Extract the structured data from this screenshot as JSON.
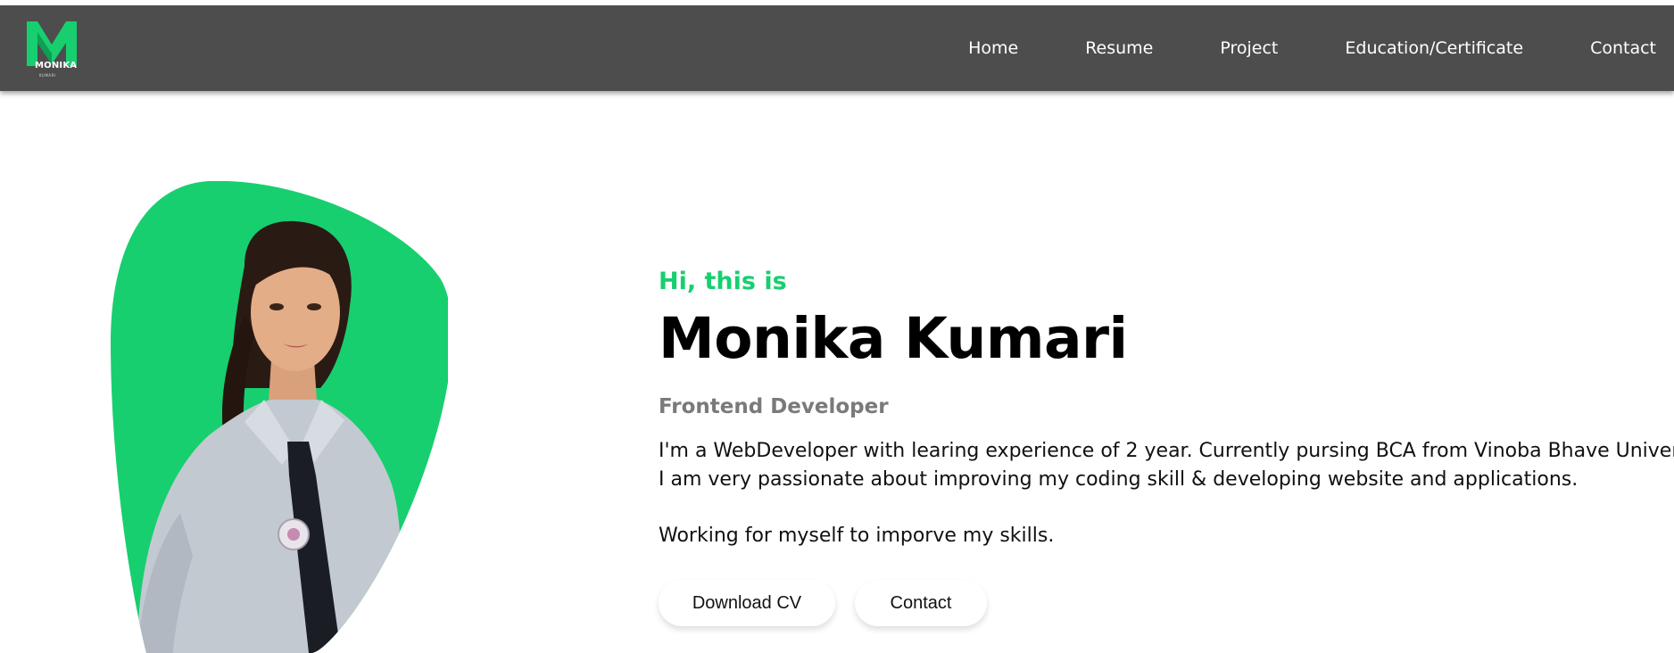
{
  "brand": {
    "logo_letter": "M",
    "logo_name": "MONIKA",
    "logo_sub": "KUMARI",
    "accent_color": "#17cf6f",
    "navbar_color": "#4d4d4d"
  },
  "nav": {
    "items": [
      {
        "label": "Home"
      },
      {
        "label": "Resume"
      },
      {
        "label": "Project"
      },
      {
        "label": "Education/Certificate"
      },
      {
        "label": "Contact"
      }
    ]
  },
  "hero": {
    "greeting": "Hi, this is",
    "name": "Monika Kumari",
    "role": "Frontend Developer",
    "description_lines": [
      "I'm a WebDeveloper with learing experience of 2 year. Currently pursing BCA from Vinoba Bhave University.",
      "I am very passionate about improving my coding skill & developing website and applications."
    ],
    "tagline": "Working for myself to imporve my skills.",
    "portrait_icon": "profile-photo",
    "buttons": {
      "download_cv": "Download CV",
      "contact": "Contact"
    }
  }
}
